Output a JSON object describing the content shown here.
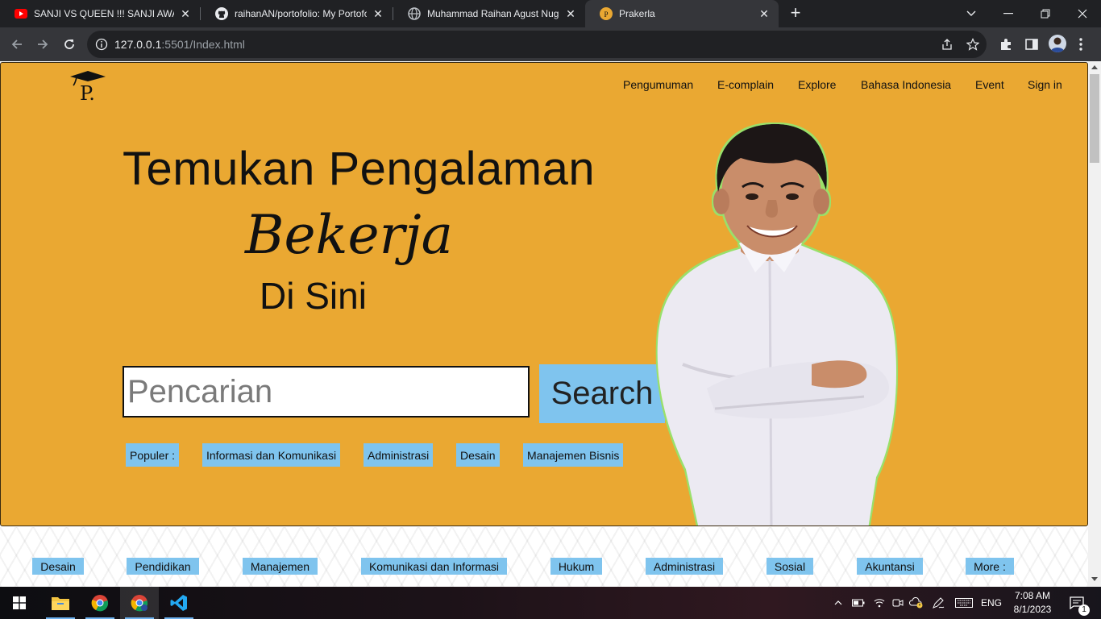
{
  "browser": {
    "tabs": [
      {
        "title": "SANJI VS QUEEN !!! SANJI AWAKENS",
        "favicon": "youtube-icon",
        "active": false
      },
      {
        "title": "raihanAN/portofolio: My Portofolio",
        "favicon": "github-icon",
        "active": false
      },
      {
        "title": "Muhammad Raihan Agust Nugroho",
        "favicon": "globe-icon",
        "active": false
      },
      {
        "title": "Prakerla",
        "favicon": "prakerla-icon",
        "active": true
      }
    ],
    "address": {
      "host": "127.0.0.1",
      "rest": ":5501/Index.html"
    }
  },
  "page": {
    "nav": [
      "Pengumuman",
      "E-complain",
      "Explore",
      "Bahasa Indonesia",
      "Event",
      "Sign in"
    ],
    "hero": {
      "line1": "Temukan Pengalaman",
      "line2": "Bekerja",
      "line3": "Di Sini"
    },
    "search": {
      "placeholder": "Pencarian",
      "button": "Search"
    },
    "popular": [
      "Populer :",
      "Informasi dan Komunikasi",
      "Administrasi",
      "Desain",
      "Manajemen Bisnis"
    ],
    "categories": [
      "Desain",
      "Pendidikan",
      "Manajemen",
      "Komunikasi dan Informasi",
      "Hukum",
      "Administrasi",
      "Sosial",
      "Akuntansi",
      "More :"
    ]
  },
  "taskbar": {
    "language": "ENG",
    "time": "7:08 AM",
    "date": "8/1/2023",
    "notifications": "1"
  }
}
